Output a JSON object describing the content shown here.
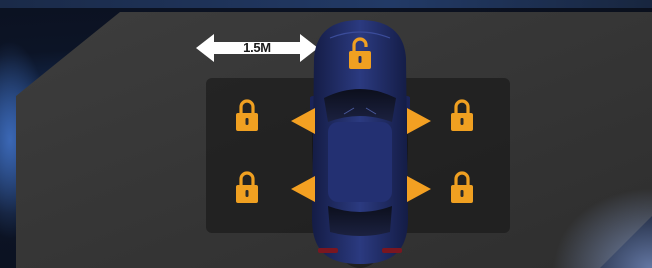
{
  "distance": {
    "label": "1.5M"
  },
  "colors": {
    "lock_orange": "#f0a021",
    "arrow_orange": "#f3a022",
    "car_body": "#1f2b66",
    "distance_arrow": "#ffffff"
  },
  "icons": {
    "roof_lock": "unlocked-padlock-icon",
    "side_locks": "locked-padlock-icon",
    "arrows": "triangle-arrow-icon"
  }
}
